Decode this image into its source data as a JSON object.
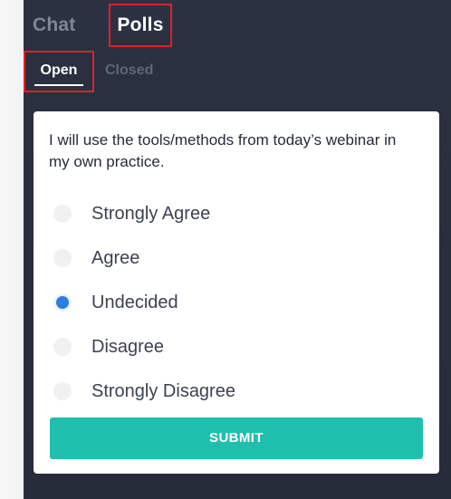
{
  "tabs": {
    "chat": "Chat",
    "polls": "Polls"
  },
  "sub_tabs": {
    "open": "Open",
    "closed": "Closed"
  },
  "poll": {
    "question": "I will use the tools/methods from today’s webinar in my own practice.",
    "options": [
      {
        "label": "Strongly Agree",
        "selected": false
      },
      {
        "label": "Agree",
        "selected": false
      },
      {
        "label": "Undecided",
        "selected": true
      },
      {
        "label": "Disagree",
        "selected": false
      },
      {
        "label": "Strongly Disagree",
        "selected": false
      }
    ],
    "submit_label": "SUBMIT"
  },
  "colors": {
    "panel_bg": "#2b3140",
    "highlight_border": "#e0202a",
    "radio_selected": "#2a7de1",
    "submit_bg": "#1fbfae"
  }
}
